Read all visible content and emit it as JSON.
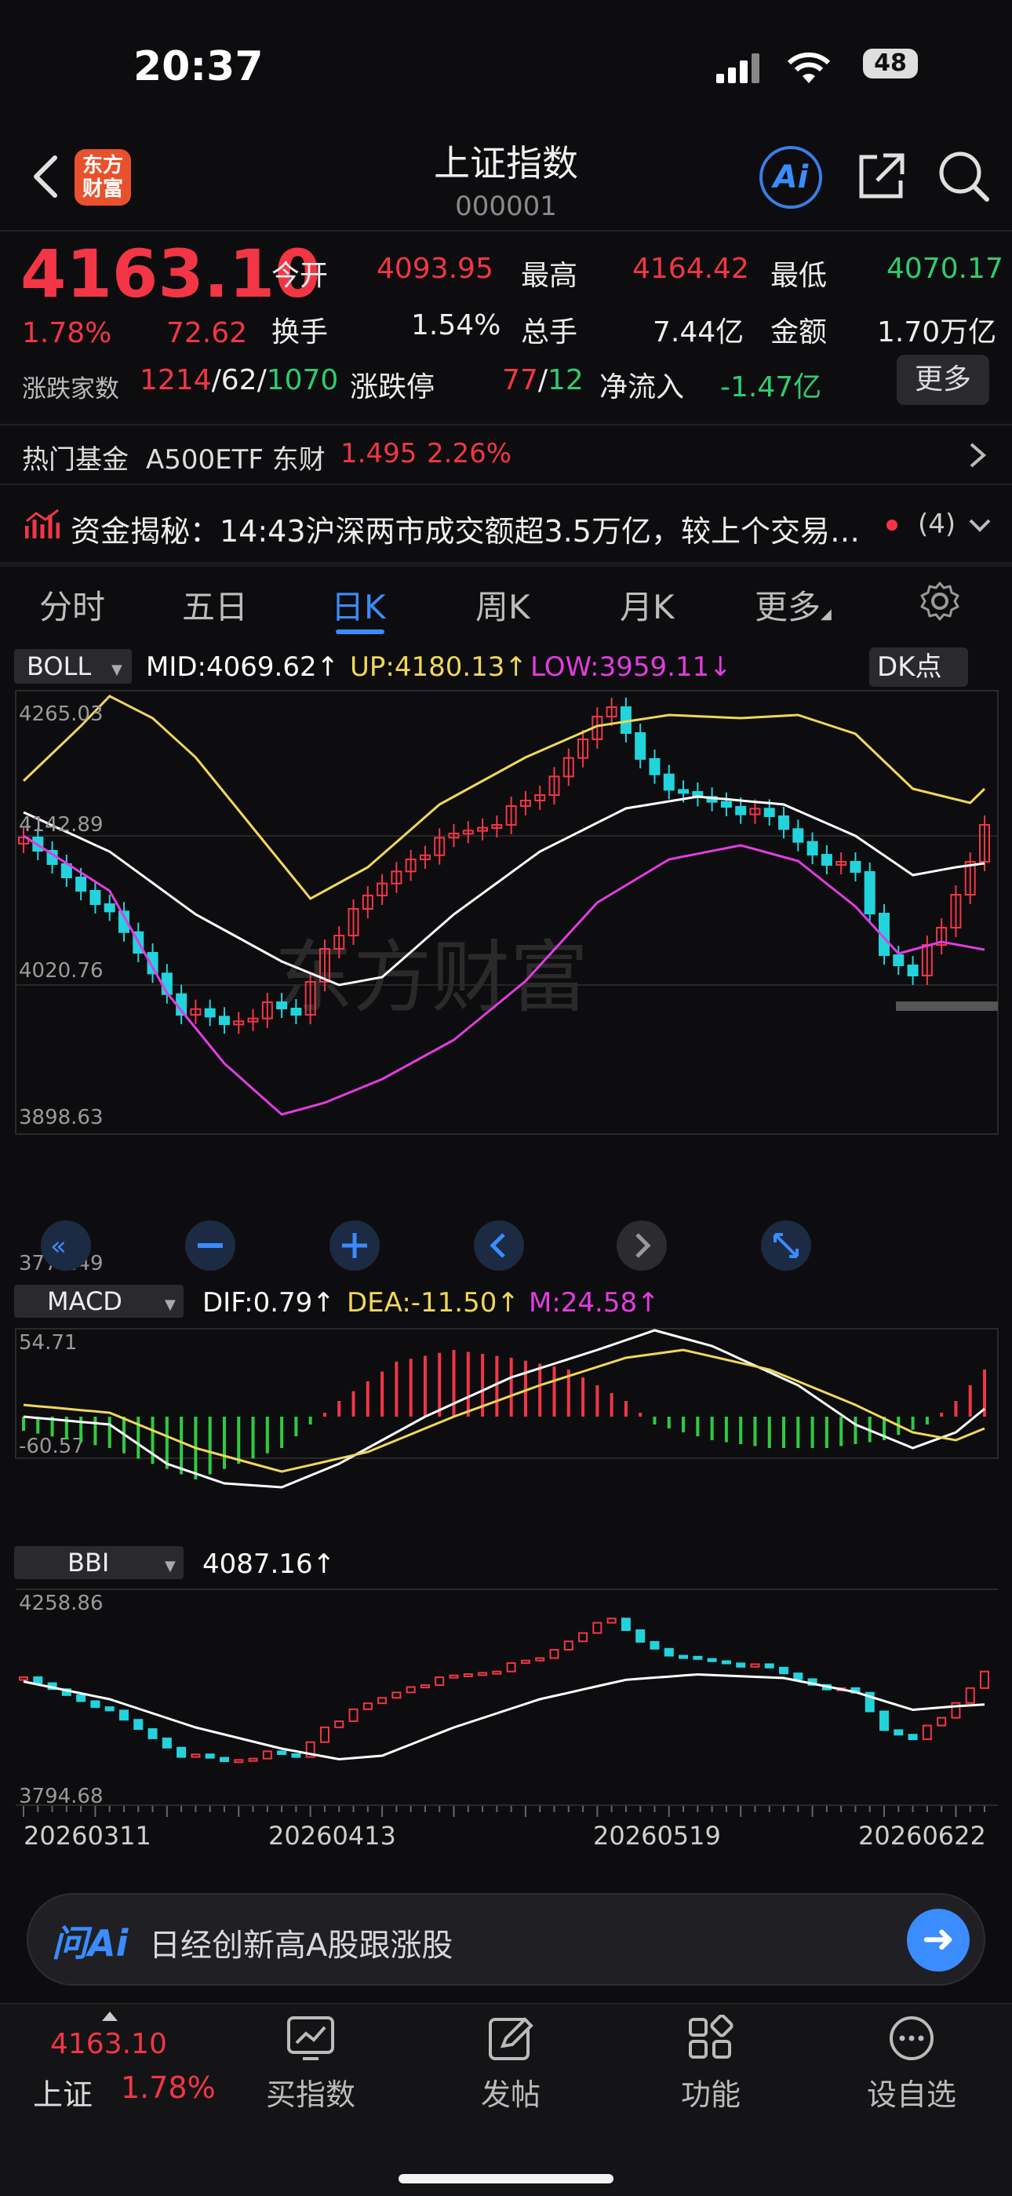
{
  "status_bar": {
    "time": "20:37",
    "battery": "48"
  },
  "header": {
    "logo_text": "东方\n财富",
    "title": "上证指数",
    "code": "000001",
    "ai_label": "Ai"
  },
  "quote": {
    "price": "4163.10",
    "change_pct": "1.78%",
    "change_amt": "72.62",
    "open_label": "今开",
    "open": "4093.95",
    "high_label": "最高",
    "high": "4164.42",
    "low_label": "最低",
    "low": "4070.17",
    "turnover_label": "换手",
    "turnover": "1.54%",
    "volume_label": "总手",
    "volume": "7.44亿",
    "amount_label": "金额",
    "amount": "1.70万亿",
    "breadth_label": "涨跌家数",
    "breadth_up": "1214",
    "breadth_flat": "62",
    "breadth_down": "1070",
    "limit_label": "涨跌停",
    "limit_up": "77",
    "limit_down": "12",
    "netflow_label": "净流入",
    "netflow": "-1.47亿",
    "more_label": "更多"
  },
  "hot_fund": {
    "label": "热门基金",
    "name": "A500ETF 东财",
    "price": "1.495",
    "pct": "2.26%"
  },
  "news": {
    "text": "资金揭秘：14:43沪深两市成交额超3.5万亿，较上个交易…",
    "count": "(4)"
  },
  "tabs": [
    "分时",
    "五日",
    "日K",
    "周K",
    "月K",
    "更多"
  ],
  "active_tab": "日K",
  "chart": {
    "boll_label": "BOLL",
    "mid": "MID:4069.62",
    "up": "UP:4180.13",
    "low": "LOW:3959.11",
    "dk_label": "DK点",
    "main_yticks": [
      "4265.03",
      "4142.89",
      "4020.76",
      "3898.63",
      "3776.49"
    ],
    "watermark": "东方财富",
    "macd_label": "MACD",
    "dif": "DIF:0.79",
    "dea": "DEA:-11.50",
    "m": "M:24.58",
    "macd_yticks": [
      "54.71",
      "-60.57"
    ],
    "bbi_label": "BBI",
    "bbi_value": "4087.16",
    "bbi_yticks": [
      "4258.86",
      "3794.68"
    ],
    "dates": [
      "20260311",
      "20260413",
      "20260519",
      "20260622"
    ],
    "colors": {
      "up": "#f23645",
      "down": "#22d3dc",
      "boll_up": "#f0d75a",
      "boll_mid": "#ffffff",
      "boll_low": "#e23ce0"
    }
  },
  "ask_ai": {
    "logo": "问Ai",
    "prompt": "日经创新高A股跟涨股"
  },
  "bottom_nav": {
    "index_price": "4163.10",
    "index_name": "上证",
    "index_pct": "1.78%",
    "items": [
      "买指数",
      "发帖",
      "功能",
      "设自选"
    ]
  }
}
